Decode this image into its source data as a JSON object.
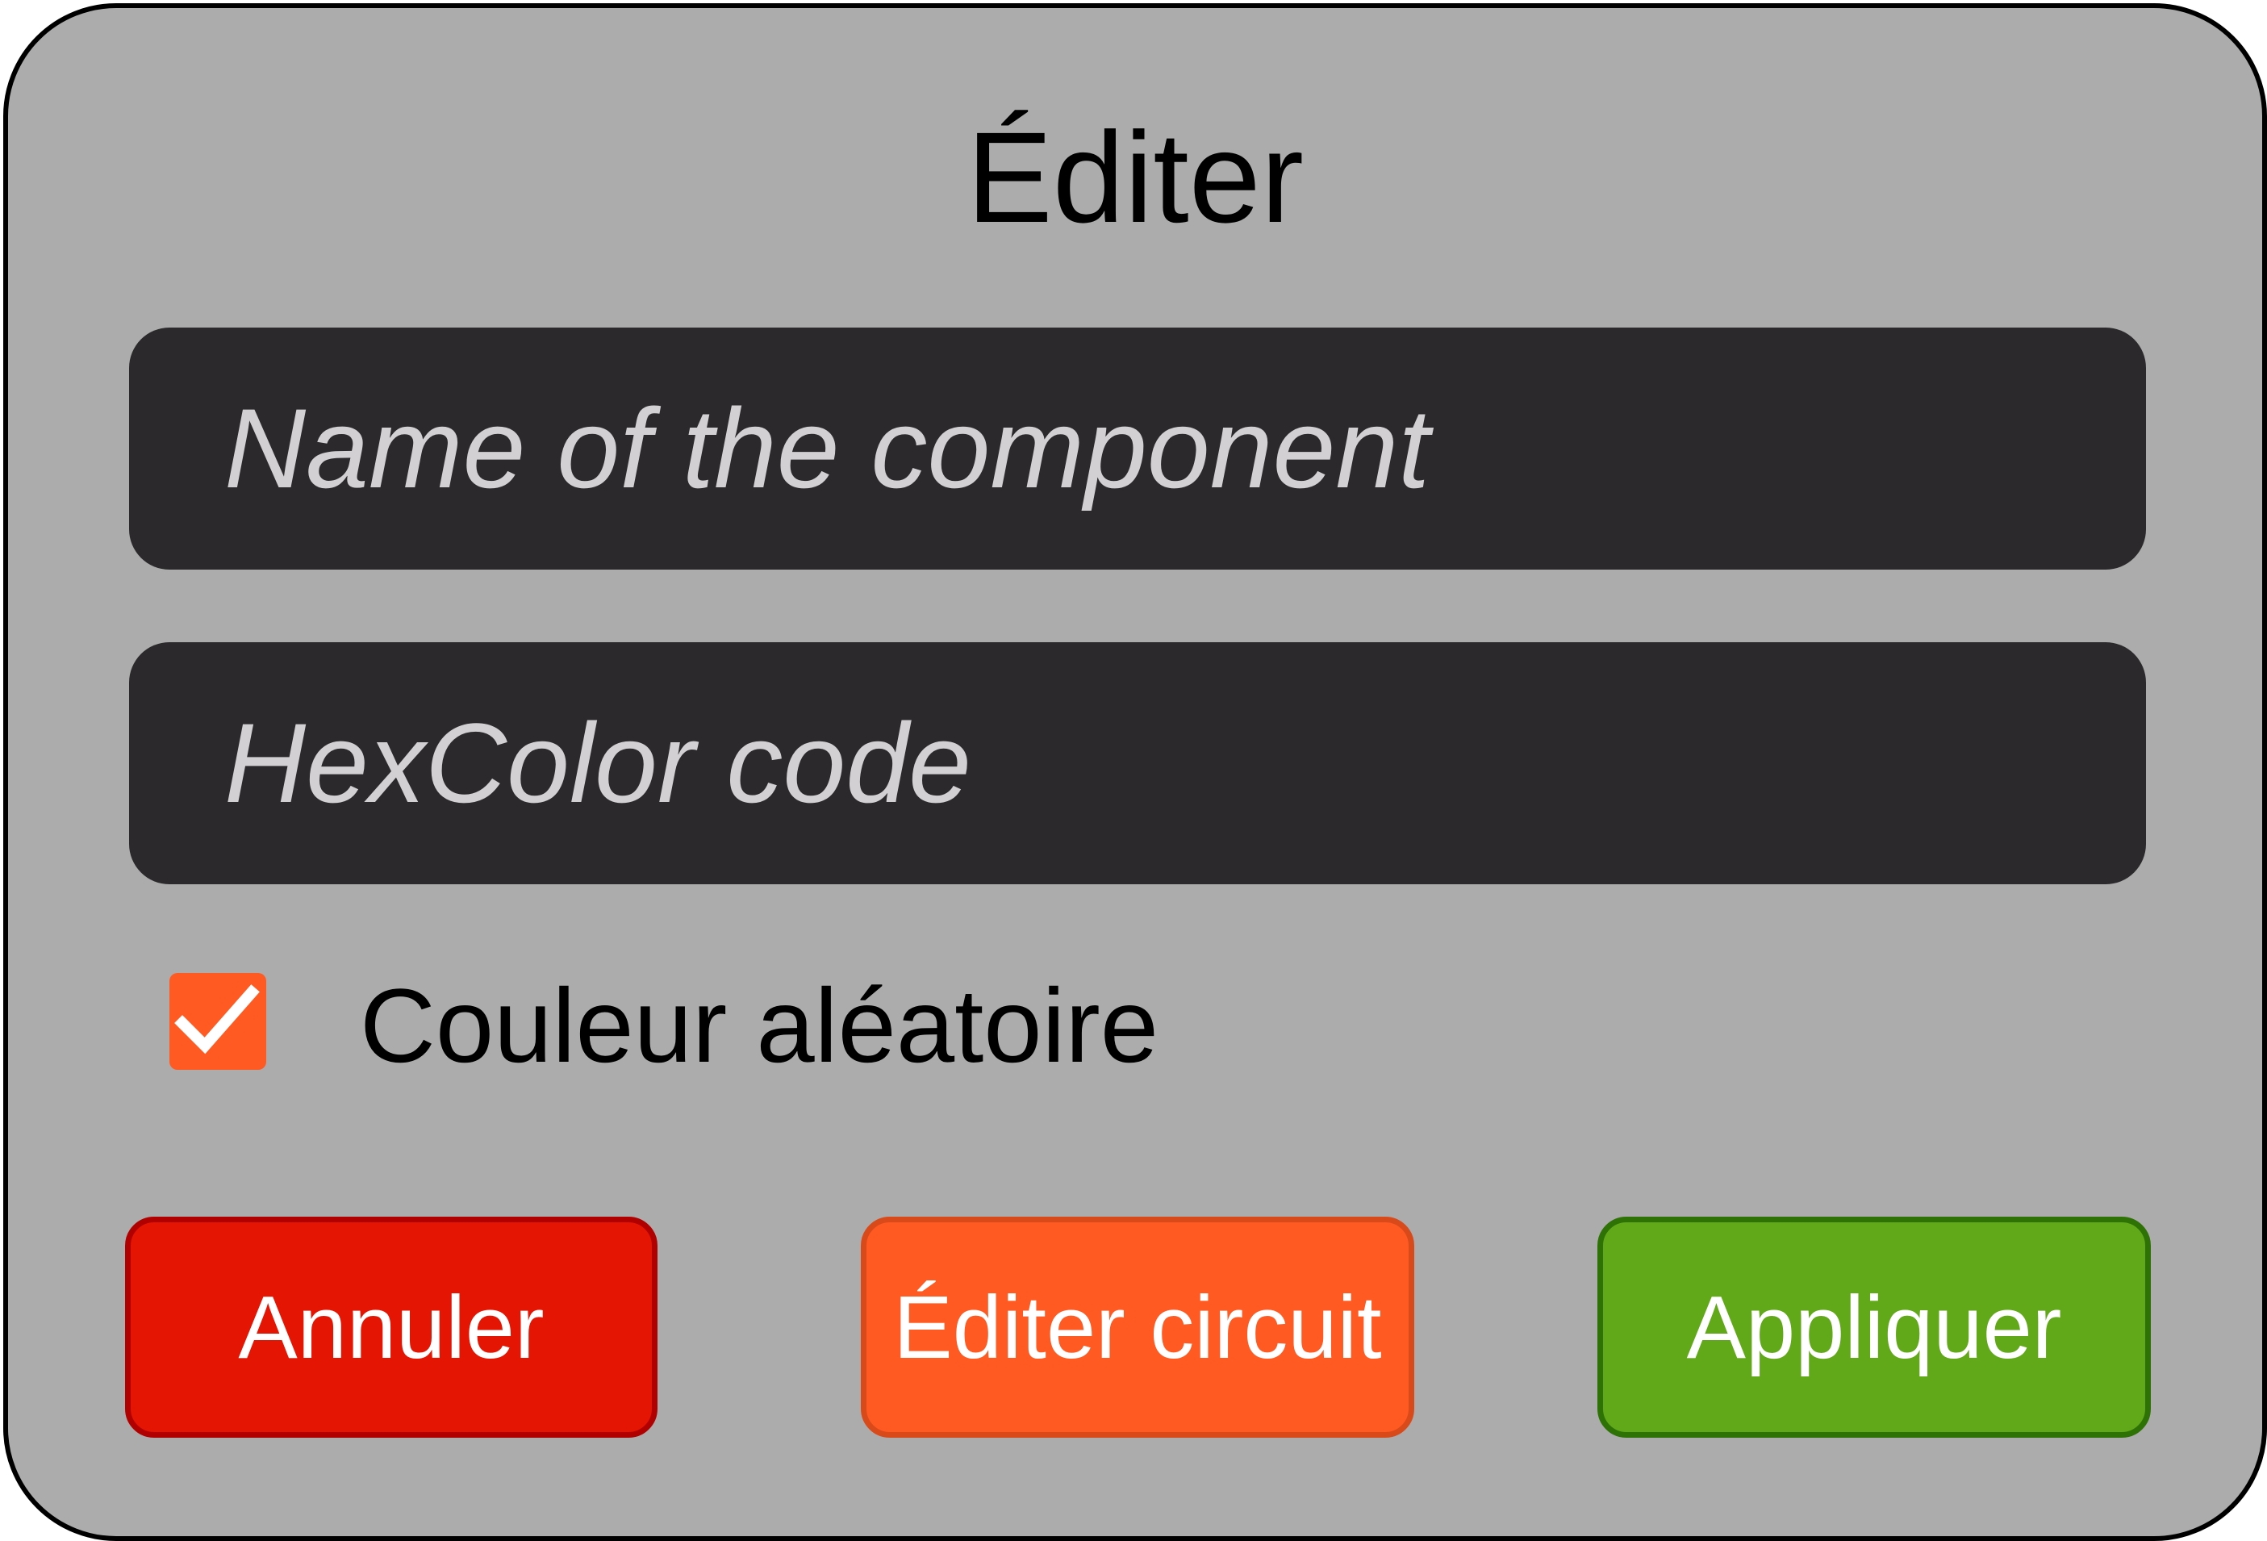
{
  "dialog": {
    "title": "Éditer",
    "name_field": {
      "value": "",
      "placeholder": "Name of the component"
    },
    "hex_field": {
      "value": "",
      "placeholder": "HexColor code"
    },
    "random_color": {
      "label": "Couleur aléatoire",
      "checked": true
    },
    "buttons": {
      "cancel": "Annuler",
      "edit_circuit": "Éditer circuit",
      "apply": "Appliquer"
    }
  },
  "colors": {
    "dialog_bg": "#acacac",
    "field_bg": "#2b292b",
    "placeholder_text": "#d2d0d2",
    "checkbox": "#ff5a22",
    "cancel": "#e41502",
    "edit_circuit": "#ff5a22",
    "apply": "#62a91a"
  },
  "icons": {
    "checkbox_mark": "check-icon"
  }
}
